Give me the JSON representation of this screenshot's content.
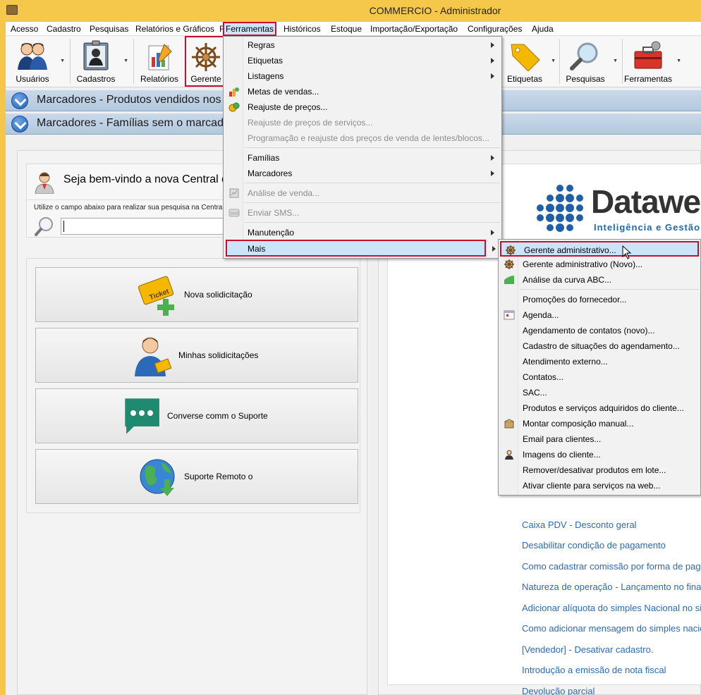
{
  "window": {
    "title": "COMMERCIO - Administrador"
  },
  "menubar": [
    "Acesso",
    "Cadastro",
    "Pesquisas",
    "Relatórios e Gráficos",
    "F",
    "Ferramentas",
    "Históricos",
    "Estoque",
    "Importação/Exportação",
    "Configurações",
    "Ajuda"
  ],
  "toolbar": {
    "usuarios": "Usuários",
    "cadastros": "Cadastros",
    "relatorios": "Relatórios",
    "gerente": "Gerente",
    "etiquetas": "Etiquetas",
    "pesquisas": "Pesquisas",
    "ferramentas": "Ferramentas"
  },
  "accordion": [
    "Marcadores - Produtos vendidos nos últimos",
    "Marcadores - Famílias sem o marcador"
  ],
  "welcome": {
    "title": "Seja bem-vindo a nova Central de",
    "hint": "Utilize o campo abaixo para realizar sua pesquisa na Central",
    "search_value": ""
  },
  "support_buttons": [
    {
      "label": "Nova solidicitação",
      "icon": "ticket-add-icon"
    },
    {
      "label": "Minhas solidicitações",
      "icon": "user-ticket-icon"
    },
    {
      "label": "Converse comm o Suporte",
      "icon": "chat-icon"
    },
    {
      "label": "Suporte Remoto o",
      "icon": "globe-download-icon"
    }
  ],
  "logo": {
    "name": "Datawe",
    "tagline": "Inteligência e Gestão"
  },
  "links": [
    "Caixa PDV - Desconto geral",
    "Desabilitar condição de pagamento",
    "Como cadastrar comissão por forma de pagamento",
    "Natureza de operação - Lançamento no financeiro",
    "Adicionar alíquota do simples Nacional no sistema",
    "Como adicionar mensagem do simples nacional",
    "[Vendedor] - Desativar cadastro.",
    "Introdução a emissão de nota fiscal",
    "Devolução parcial"
  ],
  "ferramentas_menu": {
    "regras": "Regras",
    "etiquetas": "Etiquetas",
    "listagens": "Listagens",
    "metas": "Metas de vendas...",
    "reajuste_precos": "Reajuste de preços...",
    "reajuste_servicos": "Reajuste de preços de serviços...",
    "programacao": "Programação e reajuste dos preços de venda de lentes/blocos...",
    "familias": "Famílias",
    "marcadores": "Marcadores",
    "analise": "Análise de venda...",
    "sms": "Enviar SMS...",
    "manutencao": "Manutenção",
    "mais": "Mais"
  },
  "mais_menu": {
    "gerente_adm": "Gerente administrativo...",
    "gerente_adm_novo": "Gerente administrativo (Novo)...",
    "curva_abc": "Análise da curva ABC...",
    "promocoes": "Promoções do fornecedor...",
    "agenda": "Agenda...",
    "agendamento_contatos": "Agendamento de contatos (novo)...",
    "situacoes": "Cadastro de situações do agendamento...",
    "atendimento": "Atendimento externo...",
    "contatos": "Contatos...",
    "sac": "SAC...",
    "produtos_servicos": "Produtos e serviços adquiridos do cliente...",
    "composicao": "Montar composição manual...",
    "email": "Email para clientes...",
    "imagens": "Imagens do cliente...",
    "remover": "Remover/desativar produtos em lote...",
    "ativar": "Ativar cliente para serviços na web..."
  }
}
